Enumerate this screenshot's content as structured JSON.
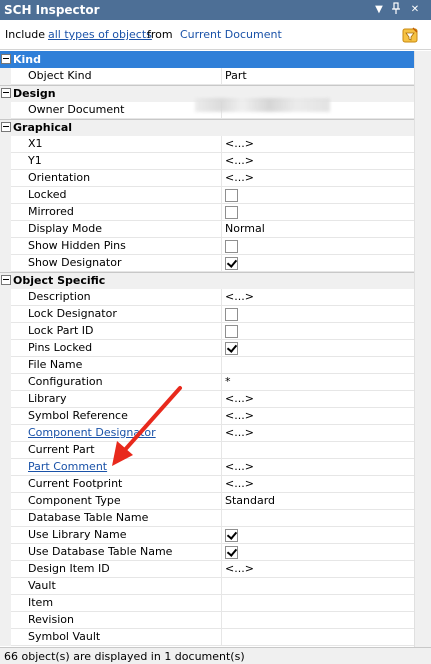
{
  "window": {
    "title": "SCH Inspector",
    "dropdown_glyph": "▼",
    "pin_glyph": "ᵽ",
    "close_glyph": "✕"
  },
  "filter": {
    "prefix": "Include",
    "object_types_link": "all types of objects",
    "middle": "from",
    "scope_link": "Current Document"
  },
  "categories": [
    {
      "label": "Kind",
      "selected": true,
      "rows": [
        {
          "name": "Object Kind",
          "value": "Part"
        }
      ]
    },
    {
      "label": "Design",
      "selected": false,
      "rows": [
        {
          "name": "Owner Document",
          "value": ""
        }
      ]
    },
    {
      "label": "Graphical",
      "selected": false,
      "rows": [
        {
          "name": "X1",
          "value": "<...>"
        },
        {
          "name": "Y1",
          "value": "<...>"
        },
        {
          "name": "Orientation",
          "value": "<...>"
        },
        {
          "name": "Locked",
          "checkbox": false
        },
        {
          "name": "Mirrored",
          "checkbox": false
        },
        {
          "name": "Display Mode",
          "value": "Normal"
        },
        {
          "name": "Show Hidden Pins",
          "checkbox": false
        },
        {
          "name": "Show Designator",
          "checkbox": true
        }
      ]
    },
    {
      "label": "Object Specific",
      "selected": false,
      "rows": [
        {
          "name": "Description",
          "value": "<...>"
        },
        {
          "name": "Lock Designator",
          "checkbox": false
        },
        {
          "name": "Lock Part ID",
          "checkbox": false
        },
        {
          "name": "Pins Locked",
          "checkbox": true
        },
        {
          "name": "File Name",
          "value": ""
        },
        {
          "name": "Configuration",
          "value": "*"
        },
        {
          "name": "Library",
          "value": "<...>"
        },
        {
          "name": "Symbol Reference",
          "value": "<...>"
        },
        {
          "name": "Component Designator",
          "value": "<...>",
          "link": true
        },
        {
          "name": "Current Part",
          "value": ""
        },
        {
          "name": "Part Comment",
          "value": "<...>",
          "link": true
        },
        {
          "name": "Current Footprint",
          "value": "<...>"
        },
        {
          "name": "Component Type",
          "value": "Standard"
        },
        {
          "name": "Database Table Name",
          "value": ""
        },
        {
          "name": "Use Library Name",
          "checkbox": true
        },
        {
          "name": "Use Database Table Name",
          "checkbox": true
        },
        {
          "name": "Design Item ID",
          "value": "<...>"
        },
        {
          "name": "Vault",
          "value": ""
        },
        {
          "name": "Item",
          "value": ""
        },
        {
          "name": "Revision",
          "value": ""
        },
        {
          "name": "Symbol Vault",
          "value": ""
        }
      ]
    }
  ],
  "status": {
    "text": "66 object(s) are displayed in 1 document(s)"
  },
  "colors": {
    "title_bar": "#4d6f96",
    "selected_category": "#2f7fd8",
    "link": "#1a52a8",
    "annotation_arrow": "#e8291c"
  }
}
